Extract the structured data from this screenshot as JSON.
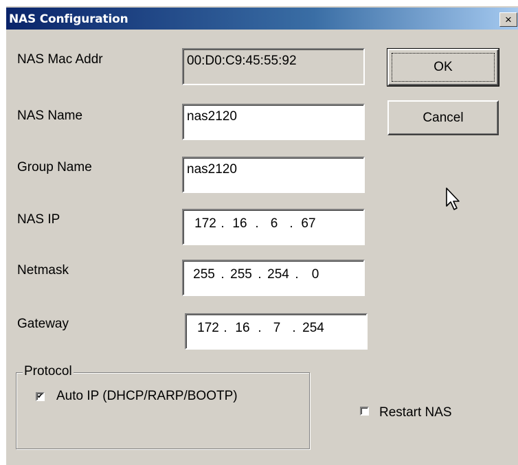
{
  "window": {
    "title": "NAS Configuration",
    "close_glyph": "×"
  },
  "fields": {
    "mac": {
      "label": "NAS Mac Addr",
      "value": "00:D0:C9:45:55:92"
    },
    "name": {
      "label": "NAS Name",
      "value": "nas2120"
    },
    "group": {
      "label": "Group Name",
      "value": "nas2120"
    },
    "ip": {
      "label": "NAS IP",
      "octets": [
        "172",
        "16",
        "6",
        "67"
      ]
    },
    "netmask": {
      "label": "Netmask",
      "octets": [
        "255",
        "255",
        "254",
        "0"
      ]
    },
    "gateway": {
      "label": "Gateway",
      "octets": [
        "172",
        "16",
        "7",
        "254"
      ]
    }
  },
  "buttons": {
    "ok": "OK",
    "cancel": "Cancel"
  },
  "protocol": {
    "group_label": "Protocol",
    "auto_ip_label": "Auto IP (DHCP/RARP/BOOTP)",
    "auto_ip_checked": true
  },
  "restart": {
    "label": "Restart NAS",
    "checked": false
  },
  "icons": {
    "checkmark": "✔",
    "close": "close-icon",
    "cursor": "mouse-pointer-icon"
  }
}
